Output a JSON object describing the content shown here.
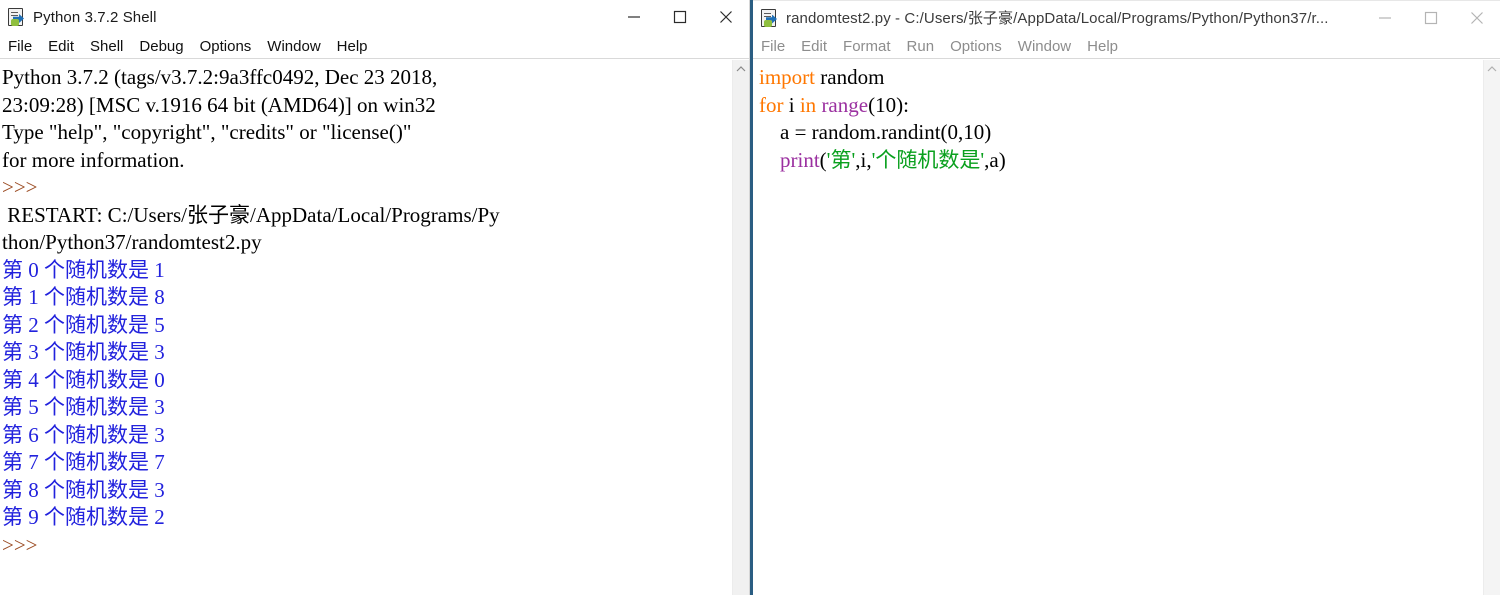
{
  "shell_window": {
    "icon": "python-idle-icon",
    "title": "Python 3.7.2 Shell",
    "state": "active",
    "menus": [
      "File",
      "Edit",
      "Shell",
      "Debug",
      "Options",
      "Window",
      "Help"
    ],
    "caption_buttons": {
      "minimize": "minimize-icon",
      "maximize": "maximize-icon",
      "close": "close-icon"
    },
    "banner": [
      "Python 3.7.2 (tags/v3.7.2:9a3ffc0492, Dec 23 2018,",
      "23:09:28) [MSC v.1916 64 bit (AMD64)] on win32",
      "Type \"help\", \"copyright\", \"credits\" or \"license()\"",
      "for more information."
    ],
    "prompt": ">>>",
    "restart": [
      " RESTART: C:/Users/张子豪/AppData/Local/Programs/Py",
      "thon/Python37/randomtest2.py"
    ],
    "output_lines": [
      "第 0 个随机数是 1",
      "第 1 个随机数是 8",
      "第 2 个随机数是 5",
      "第 3 个随机数是 3",
      "第 4 个随机数是 0",
      "第 5 个随机数是 3",
      "第 6 个随机数是 3",
      "第 7 个随机数是 7",
      "第 8 个随机数是 3",
      "第 9 个随机数是 2"
    ],
    "trailing_prompt": ">>>"
  },
  "editor_window": {
    "icon": "python-idle-icon",
    "title": "randomtest2.py - C:/Users/张子豪/AppData/Local/Programs/Python/Python37/r...",
    "state": "inactive",
    "menus": [
      "File",
      "Edit",
      "Format",
      "Run",
      "Options",
      "Window",
      "Help"
    ],
    "caption_buttons": {
      "minimize": "minimize-icon",
      "maximize": "maximize-icon",
      "close": "close-icon"
    },
    "code": {
      "l1_kw": "import",
      "l1_rest": " random",
      "l2_kw1": "for",
      "l2_mid": " i ",
      "l2_kw2": "in",
      "l2_sp": " ",
      "l2_builtin": "range",
      "l2_tail": "(10):",
      "l3": "    a = random.randint(0,10)",
      "l4_indent": "    ",
      "l4_builtin": "print",
      "l4_open": "(",
      "l4_str1": "'第'",
      "l4_mid": ",i,",
      "l4_str2": "'个随机数是'",
      "l4_close": ",a)"
    }
  },
  "colors": {
    "keyword": "#ff7700",
    "builtin": "#9b30a0",
    "string": "#0aa01e",
    "stdout": "#2222dd",
    "prompt": "#9b4b22",
    "active_border": "#2a5d82"
  },
  "scrollbar": {
    "up_arrow_icon": "chevron-up-icon"
  }
}
